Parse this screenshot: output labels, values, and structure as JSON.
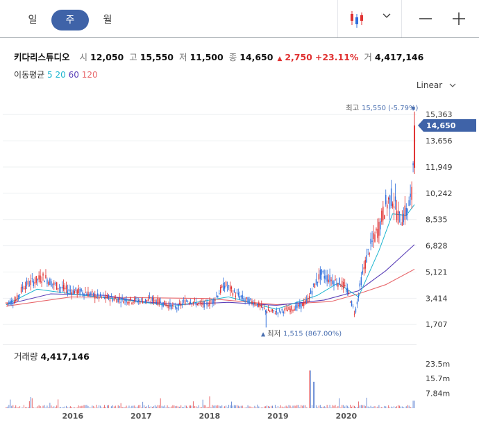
{
  "periods": [
    {
      "label": "일",
      "active": false
    },
    {
      "label": "주",
      "active": true
    },
    {
      "label": "월",
      "active": false
    }
  ],
  "stock": {
    "name": "키다리스튜디오",
    "open_label": "시",
    "open": "12,050",
    "high_label": "고",
    "high": "15,550",
    "low_label": "저",
    "low": "11,500",
    "close_label": "종",
    "close": "14,650",
    "change": "2,750",
    "change_pct": "+23.11%",
    "volume_label": "거",
    "volume": "4,417,146"
  },
  "moving_average": {
    "label": "이동평균",
    "periods": [
      {
        "label": "5",
        "color": "#1bb5cf"
      },
      {
        "label": "20",
        "color": "#1bb5cf"
      },
      {
        "label": "60",
        "color": "#5a3fb8"
      },
      {
        "label": "120",
        "color": "#e8676b"
      }
    ]
  },
  "scale_mode": "Linear",
  "volume_panel": {
    "label": "거래량",
    "value": "4,417,146"
  },
  "chart_data": {
    "type": "candlestick",
    "price_axis": {
      "ticks": [
        "15,363",
        "13,656",
        "11,949",
        "10,242",
        "8,535",
        "6,828",
        "5,121",
        "3,414",
        "1,707"
      ],
      "tick_values": [
        15363,
        13656,
        11949,
        10242,
        8535,
        6828,
        5121,
        3414,
        1707
      ],
      "range": [
        500,
        16500
      ]
    },
    "current_price_label": "14,650",
    "current_price": 14650,
    "high_marker": {
      "label_prefix": "최고",
      "text": "15,550 (-5.79%)",
      "value": 15550
    },
    "low_marker": {
      "label_prefix": "최저",
      "text": "1,515 (867.00%)",
      "value": 1515
    },
    "x_axis": {
      "ticks": [
        "2016",
        "2017",
        "2018",
        "2019",
        "2020"
      ],
      "tick_values": [
        2016,
        2017,
        2018,
        2019,
        2020
      ],
      "range": [
        2015.0,
        2021.05
      ]
    },
    "volume_axis": {
      "ticks": [
        "23.5m",
        "15.7m",
        "7.84m"
      ],
      "tick_values": [
        23.5,
        15.7,
        7.84
      ],
      "range": [
        0,
        29
      ]
    },
    "price_series": [
      [
        2015.05,
        3100
      ],
      [
        2015.2,
        3300
      ],
      [
        2015.3,
        4200
      ],
      [
        2015.45,
        4500
      ],
      [
        2015.6,
        4800
      ],
      [
        2015.75,
        4300
      ],
      [
        2015.9,
        4000
      ],
      [
        2016.0,
        3900
      ],
      [
        2016.2,
        3800
      ],
      [
        2016.4,
        3500
      ],
      [
        2016.6,
        3400
      ],
      [
        2016.8,
        3300
      ],
      [
        2017.0,
        3250
      ],
      [
        2017.2,
        3300
      ],
      [
        2017.4,
        3000
      ],
      [
        2017.55,
        2800
      ],
      [
        2017.7,
        3300
      ],
      [
        2017.9,
        3000
      ],
      [
        2018.05,
        3100
      ],
      [
        2018.25,
        4300
      ],
      [
        2018.4,
        3700
      ],
      [
        2018.55,
        3300
      ],
      [
        2018.7,
        3100
      ],
      [
        2018.85,
        2600
      ],
      [
        2019.0,
        2500
      ],
      [
        2019.2,
        2700
      ],
      [
        2019.35,
        2900
      ],
      [
        2019.45,
        3200
      ],
      [
        2019.55,
        4200
      ],
      [
        2019.65,
        5000
      ],
      [
        2019.8,
        4600
      ],
      [
        2019.95,
        4400
      ],
      [
        2020.05,
        3800
      ],
      [
        2020.15,
        2400
      ],
      [
        2020.25,
        4800
      ],
      [
        2020.35,
        6500
      ],
      [
        2020.5,
        8000
      ],
      [
        2020.6,
        9500
      ],
      [
        2020.7,
        10000
      ],
      [
        2020.8,
        8500
      ],
      [
        2020.9,
        9000
      ],
      [
        2020.98,
        10000
      ],
      [
        2021.02,
        14650
      ]
    ],
    "ma_120": [
      [
        2015.05,
        2900
      ],
      [
        2016.0,
        3500
      ],
      [
        2017.0,
        3450
      ],
      [
        2018.0,
        3400
      ],
      [
        2019.0,
        3000
      ],
      [
        2019.8,
        3200
      ],
      [
        2020.2,
        3700
      ],
      [
        2020.6,
        4300
      ],
      [
        2021.02,
        5300
      ]
    ],
    "ma_60": [
      [
        2015.05,
        3000
      ],
      [
        2015.7,
        3700
      ],
      [
        2016.5,
        3600
      ],
      [
        2017.0,
        3200
      ],
      [
        2017.6,
        3000
      ],
      [
        2018.3,
        3150
      ],
      [
        2019.0,
        2950
      ],
      [
        2019.7,
        3300
      ],
      [
        2020.2,
        3900
      ],
      [
        2020.6,
        5200
      ],
      [
        2021.02,
        6900
      ]
    ],
    "ma_20": [
      [
        2015.05,
        3000
      ],
      [
        2015.5,
        4000
      ],
      [
        2016.0,
        3700
      ],
      [
        2016.8,
        3300
      ],
      [
        2017.5,
        2900
      ],
      [
        2018.3,
        3500
      ],
      [
        2019.0,
        2700
      ],
      [
        2019.6,
        3600
      ],
      [
        2019.9,
        4400
      ],
      [
        2020.2,
        3500
      ],
      [
        2020.5,
        6500
      ],
      [
        2020.7,
        8900
      ],
      [
        2020.9,
        8800
      ],
      [
        2021.02,
        9500
      ]
    ]
  }
}
